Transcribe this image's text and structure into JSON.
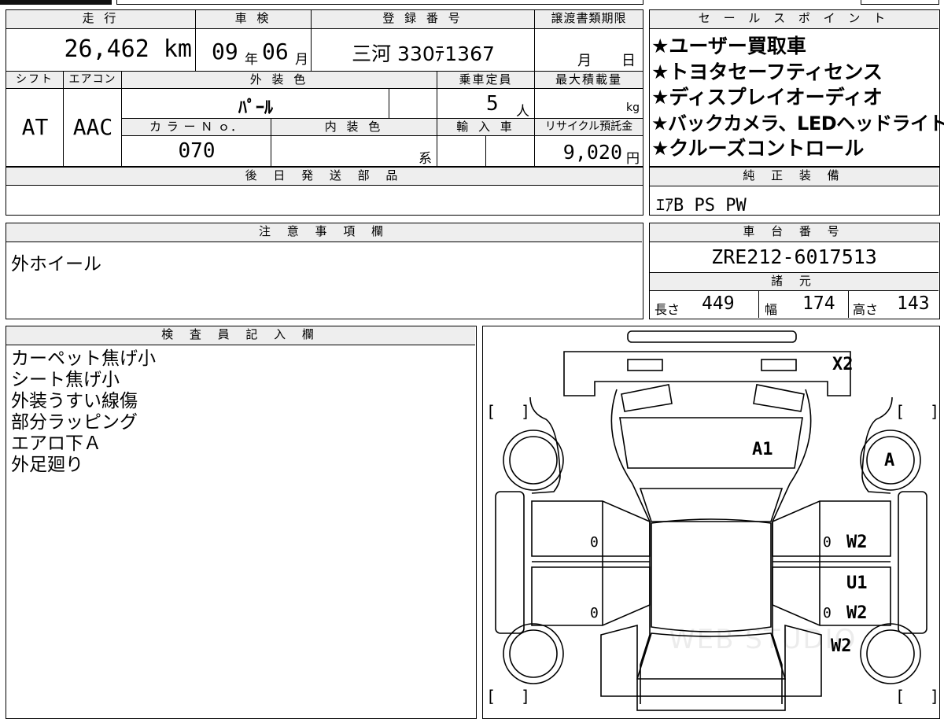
{
  "vehicle": {
    "mileage_header": "走 行",
    "mileage": "26,462 km",
    "inspection_header": "車 検",
    "inspection_year": "09",
    "inspection_year_unit": "年",
    "inspection_month": "06",
    "inspection_month_unit": "月",
    "registration_header": "登 録 番 号",
    "registration": "三河 330ﾃ1367",
    "transfer_header": "譲渡書類期限",
    "transfer_month_unit": "月",
    "transfer_day_unit": "日",
    "shift_header": "シフト",
    "shift": "AT",
    "ac_header": "エアコン",
    "ac": "AAC",
    "exterior_color_header": "外 装 色",
    "exterior_color": "ﾊﾟｰﾙ",
    "capacity_header": "乗車定員",
    "capacity": "5",
    "capacity_unit": "人",
    "max_load_header": "最大積載量",
    "max_load_unit": "kg",
    "color_no_header": "カ ラ ー Ｎ ｏ．",
    "color_no": "070",
    "interior_color_header": "内 装 色",
    "interior_color_suffix": "系",
    "import_header": "輸 入 車",
    "recycle_header": "リサイクル預託金",
    "recycle": "9,020",
    "recycle_unit": "円",
    "later_parts_header": "後 日 発 送 部 品"
  },
  "sales_points": {
    "header": "セ ー ル ス ポ イ ン ト",
    "items": [
      "★ユーザー買取車",
      "★トヨタセーフティセンス",
      "★ディスプレイオーディオ",
      "★バックカメラ、LEDヘッドライト",
      "★クルーズコントロール"
    ]
  },
  "genuine_equipment": {
    "header": "純 正 装 備",
    "value": "ｴｱB PS PW"
  },
  "notes": {
    "header": "注 意 事 項 欄",
    "value": "外ホイール"
  },
  "chassis": {
    "header": "車 台 番 号",
    "value": "ZRE212-6017513"
  },
  "specs": {
    "header": "諸 元",
    "length_label": "長さ",
    "length": "449",
    "width_label": "幅",
    "width": "174",
    "height_label": "高さ",
    "height": "143"
  },
  "inspector": {
    "header": "検 査 員 記 入 欄",
    "lines": [
      "カーペット焦げ小",
      "シート焦げ小",
      "外装うすい線傷",
      "部分ラッピング",
      "エアロ下Ａ",
      "外足廻り"
    ]
  },
  "diagram": {
    "marks": {
      "x2": "X2",
      "a1": "A1",
      "a": "A",
      "w2_front_right": "W2",
      "u1": "U1",
      "w2_rear_right": "W2",
      "w2_rear_wheel": "W2",
      "zero_left_front": "0",
      "zero_left_rear": "0",
      "zero_right_front": "0",
      "zero_right_rear": "0"
    },
    "brackets": {
      "open": "[",
      "close": "]"
    },
    "watermark": "WEB STUDIO"
  },
  "colors": {
    "header_bg": "#eeeeee",
    "line": "#000000"
  }
}
